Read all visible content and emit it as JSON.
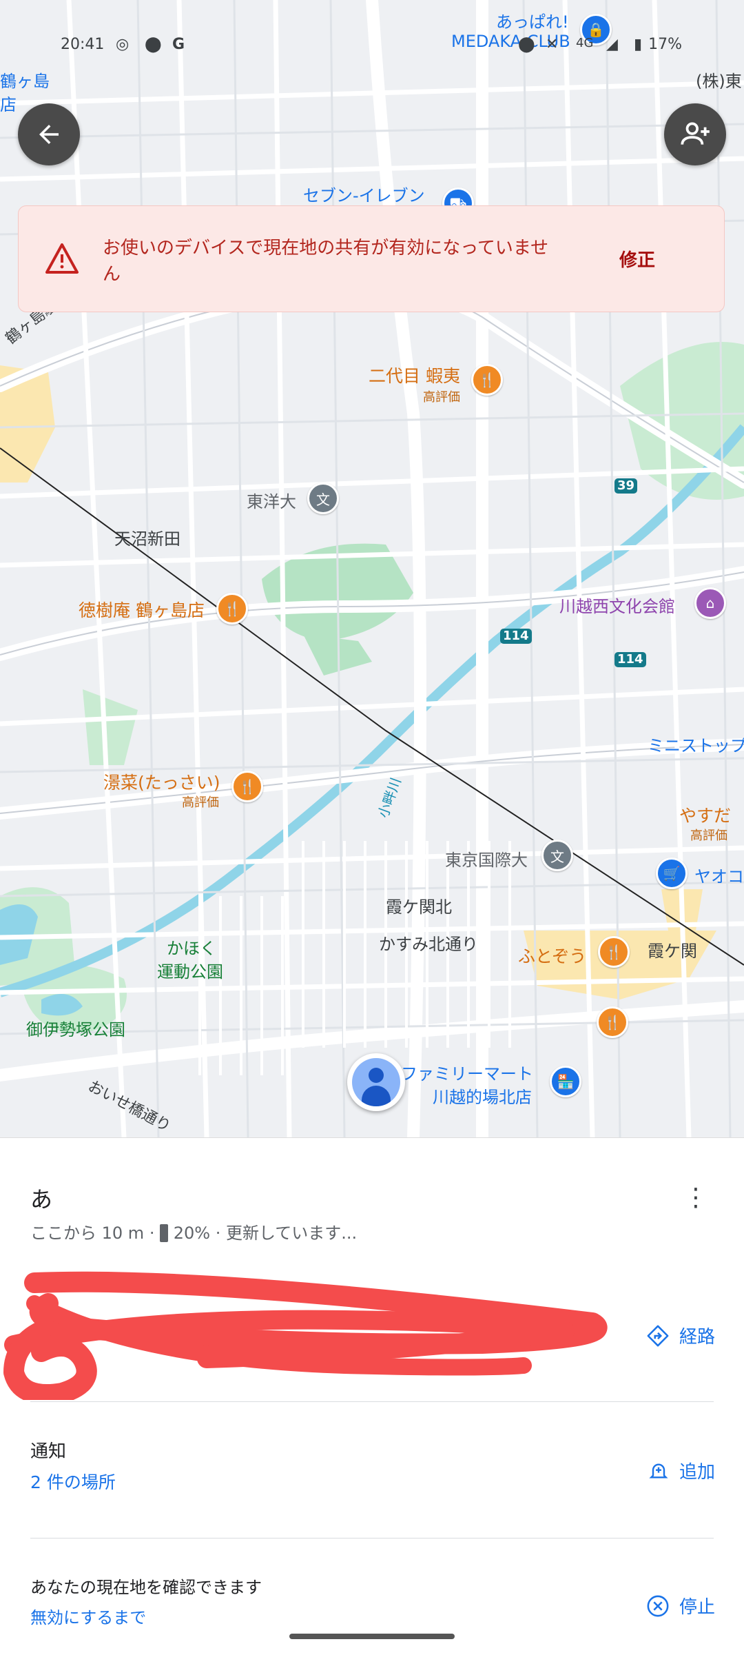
{
  "status_bar": {
    "time": "20:41",
    "battery": "17%",
    "network": "4G"
  },
  "map_labels": {
    "top_left_a": "鶴ヶ島",
    "top_left_b": "店",
    "top_right": "(株)東",
    "medaka_a": "あっぱれ!",
    "medaka_b": "MEDAKA CLUB",
    "seven": "セブン-イレブン",
    "station_road": "鶴ヶ島駅通り",
    "nidaime_name": "二代目 蝦夷",
    "nidaime_rating": "高評価",
    "toyo": "東洋大",
    "route39": "39",
    "amanuma": "天沼新田",
    "tokujuan": "徳樹庵 鶴ヶ島店",
    "kawagoe_bunka": "川越西文化会館",
    "route114a": "114",
    "route114b": "114",
    "ministop": "ミニストップ",
    "tassai_name": "澋菜(たっさい)",
    "tassai_rating": "高評価",
    "yasuda_name": "やすだ",
    "yasuda_rating": "高評価",
    "kohata": "小畔川",
    "tokyo_kokusai": "東京国際大",
    "aeon": "ヤオコ",
    "kasumi_kita": "霞ケ関北",
    "kasumi_street": "かすみ北通り",
    "futozo": "ふとぞう",
    "kasumiseki": "霞ケ関",
    "kahoku_a": "かほく",
    "kahoku_b": "運動公園",
    "oise_park": "御伊勢塚公園",
    "oise_road": "おいせ橋通り",
    "familymart_a": "ファミリーマート",
    "familymart_b": "川越的場北店"
  },
  "alert": {
    "message": "お使いのデバイスで現在地の共有が有効になっていません",
    "fix_label": "修正"
  },
  "person": {
    "name": "あ",
    "distance": "ここから 10 m",
    "battery": "20%",
    "updating": "更新しています..."
  },
  "directions_label": "経路",
  "notifications": {
    "title": "通知",
    "places": "2 件の場所",
    "add_label": "追加"
  },
  "sharing": {
    "title": "あなたの現在地を確認できます",
    "until": "無効にするまで",
    "stop_label": "停止"
  },
  "icons": {
    "back": "arrow-left-icon",
    "add_person": "person-add-icon",
    "warning": "warning-icon",
    "more": "more-vert-icon",
    "directions": "directions-icon",
    "bell": "bell-add-icon",
    "stop": "cancel-circle-icon"
  }
}
